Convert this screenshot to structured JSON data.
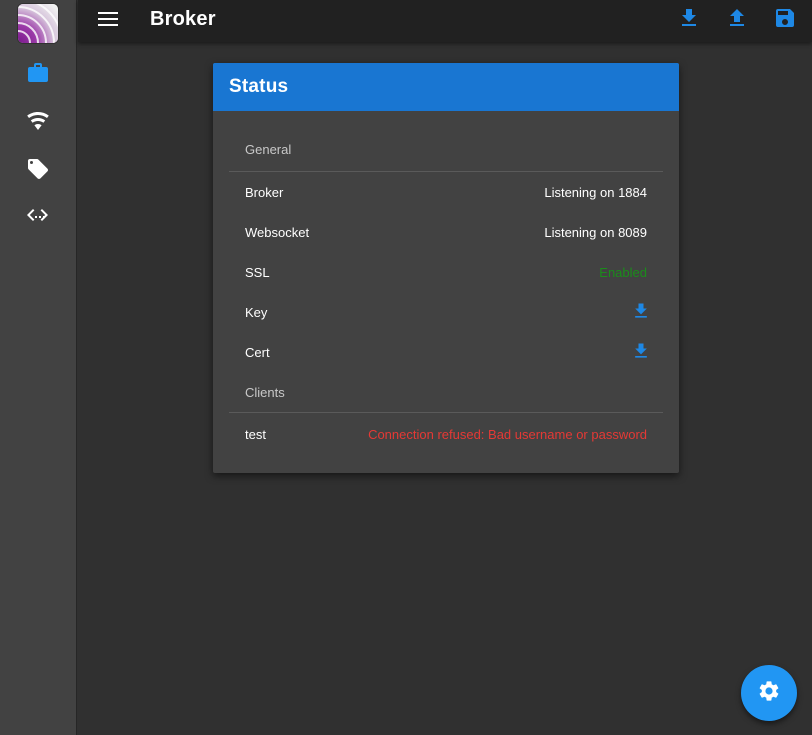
{
  "app": {
    "title": "Broker"
  },
  "colors": {
    "accent": "#1976d2",
    "sidebar_active": "#2196f3",
    "fab": "#2196f3",
    "ok": "#1b8c1b",
    "error": "#e53935"
  },
  "sidebar": {
    "items": [
      {
        "icon": "briefcase-icon",
        "active": true
      },
      {
        "icon": "wifi-icon",
        "active": false
      },
      {
        "icon": "tag-icon",
        "active": false
      },
      {
        "icon": "code-arrows-icon",
        "active": false
      }
    ]
  },
  "toolbar": {
    "actions": [
      {
        "icon": "download-icon"
      },
      {
        "icon": "upload-icon"
      },
      {
        "icon": "save-icon"
      }
    ]
  },
  "status": {
    "title": "Status",
    "general_header": "General",
    "rows": [
      {
        "label": "Broker",
        "value": "Listening on 1884"
      },
      {
        "label": "Websocket",
        "value": "Listening on 8089"
      },
      {
        "label": "SSL",
        "value": "Enabled"
      }
    ],
    "key_label": "Key",
    "cert_label": "Cert",
    "clients_header": "Clients",
    "clients": [
      {
        "name": "test",
        "status": "Connection refused: Bad username or password"
      }
    ]
  },
  "fab": {
    "icon": "gear-icon"
  }
}
